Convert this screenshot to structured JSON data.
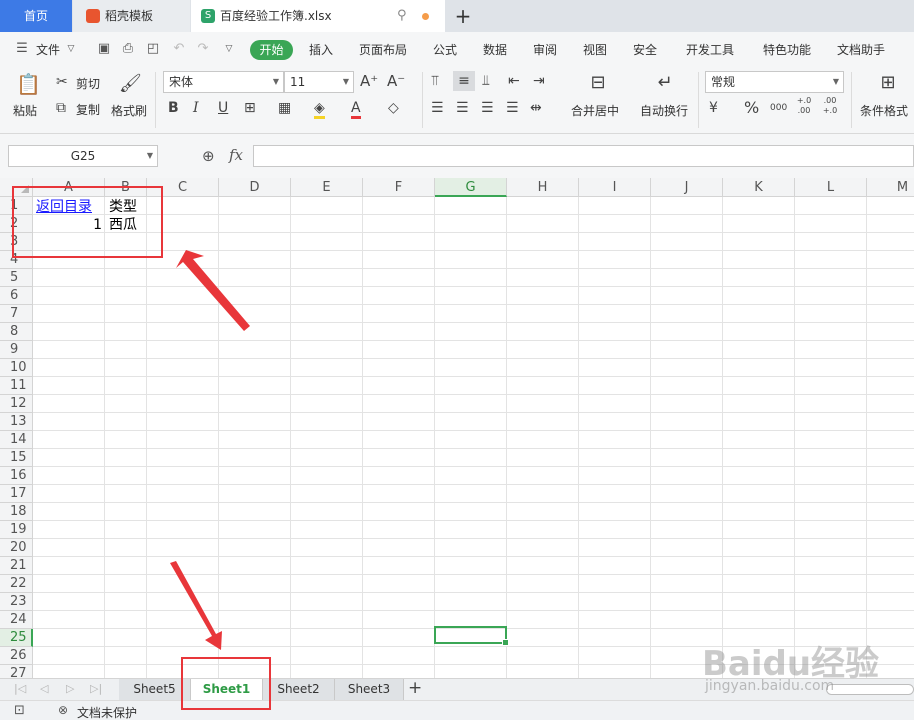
{
  "tabs": {
    "home": "首页",
    "template": "稻壳模板",
    "file_icon_letter": "S",
    "file": "百度经验工作簿.xlsx"
  },
  "menu": {
    "file": "文件",
    "items": [
      "开始",
      "插入",
      "页面布局",
      "公式",
      "数据",
      "审阅",
      "视图",
      "安全",
      "开发工具",
      "特色功能",
      "文档助手"
    ],
    "active_index": 0
  },
  "ribbon": {
    "paste": "粘贴",
    "cut": "剪切",
    "copy": "复制",
    "format_painter": "格式刷",
    "font_name": "宋体",
    "font_size": "11",
    "bold": "B",
    "italic": "I",
    "underline": "U",
    "font_color_letter": "A",
    "merge_center": "合并居中",
    "wrap_text": "自动换行",
    "number_format": "常规",
    "currency": "¥",
    "percent": "%",
    "thousands": "000",
    "inc_decimal": "+.0 .00",
    "dec_decimal": ".00 +.0",
    "conditional_format": "条件格式"
  },
  "formula_bar": {
    "name_box": "G25",
    "fx": "fx",
    "value": ""
  },
  "grid": {
    "columns": [
      "A",
      "B",
      "C",
      "D",
      "E",
      "F",
      "G",
      "H",
      "I",
      "J",
      "K",
      "L",
      "M"
    ],
    "selected_column": "G",
    "rows": [
      "1",
      "2",
      "3",
      "4",
      "5",
      "6",
      "7",
      "8",
      "9",
      "10",
      "11",
      "12",
      "13",
      "14",
      "15",
      "16",
      "17",
      "18",
      "19",
      "20",
      "21",
      "22",
      "23",
      "24",
      "25",
      "26",
      "27"
    ],
    "selected_row": "25",
    "cells": {
      "A1": "返回目录",
      "B1": "类型",
      "A2": "1",
      "B2": "西瓜"
    }
  },
  "sheets": {
    "tabs": [
      "Sheet5",
      "Sheet1",
      "Sheet2",
      "Sheet3"
    ],
    "active": "Sheet1",
    "add": "+"
  },
  "status": {
    "doc_protection": "文档未保护"
  },
  "watermark": {
    "logo": "Baidu经验",
    "url": "jingyan.baidu.com"
  }
}
